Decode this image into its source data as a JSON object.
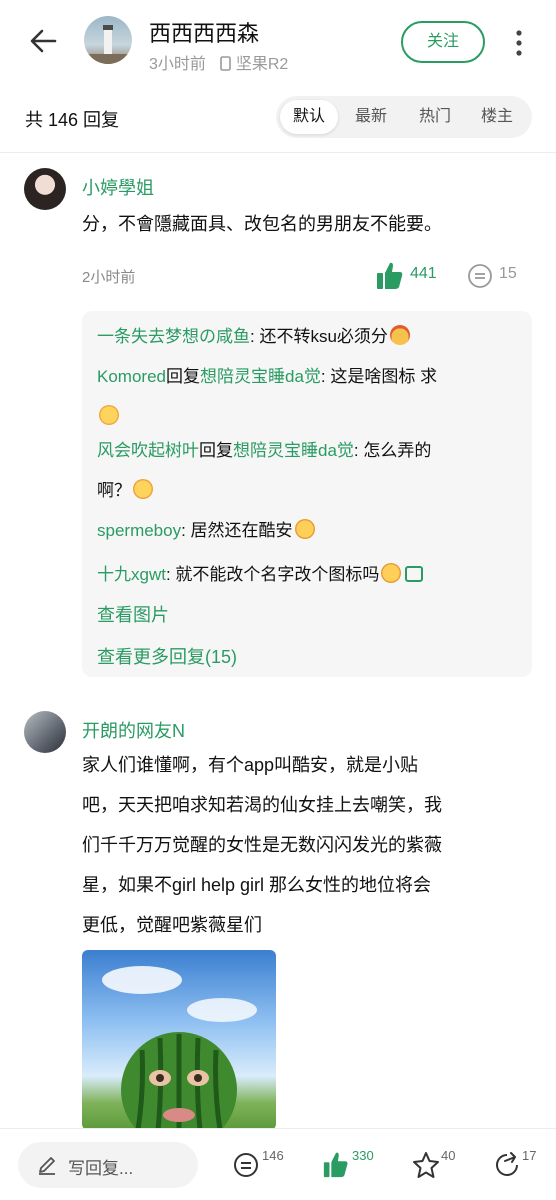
{
  "header": {
    "author_name": "西西西西森",
    "time": "3小时前",
    "device": "坚果R2",
    "follow_label": "关注"
  },
  "replies": {
    "count_label": "共 146 回复",
    "tabs": [
      {
        "label": "默认",
        "active": true
      },
      {
        "label": "最新",
        "active": false
      },
      {
        "label": "热门",
        "active": false
      },
      {
        "label": "楼主",
        "active": false
      }
    ]
  },
  "comment1": {
    "user": "小婷學姐",
    "text": "分，不會隱藏面具、改包名的男朋友不能要。",
    "time": "2小时前",
    "likes": "441",
    "reply_count": "15",
    "subreplies": [
      {
        "user": "一条失去梦想の咸鱼",
        "reply_to": "",
        "text": ": 还不转ksu必须分",
        "emoji": "angry-emoji"
      },
      {
        "user": "Komored",
        "reply_word": "回复",
        "reply_to": "想陪灵宝睡da觉",
        "text": ": 这是啥图标 求",
        "emoji": "crying-emoji"
      },
      {
        "user": "风会吹起树叶",
        "reply_word": "回复",
        "reply_to": "想陪灵宝睡da觉",
        "text": ": 怎么弄的",
        "text2": "啊？",
        "emoji": "shocked-emoji"
      },
      {
        "user": "spermeboy",
        "reply_to": "",
        "text": ": 居然还在酷安",
        "emoji": "sunglasses-emoji"
      },
      {
        "user": "十九xgwt",
        "reply_to": "",
        "text": ": 就不能改个名字改个图标吗",
        "emoji": "sunglasses-emoji"
      }
    ],
    "view_image": "查看图片",
    "view_more": "查看更多回复(15)"
  },
  "comment2": {
    "user": "开朗的网友N",
    "lines": [
      "家人们谁懂啊，有个app叫酷安，就是小贴",
      "吧，天天把咱求知若渴的仙女挂上去嘲笑，我",
      "们千千万万觉醒的女性是无数闪闪发光的紫薇",
      "星，如果不girl help girl 那么女性的地位将会",
      "更低，觉醒吧紫薇星们"
    ]
  },
  "bottom_bar": {
    "write_placeholder": "写回复...",
    "comments": "146",
    "likes": "330",
    "favorites": "40",
    "shares": "17"
  },
  "colors": {
    "accent_green": "#2a9b63",
    "meta_gray": "#9a9a9a"
  }
}
